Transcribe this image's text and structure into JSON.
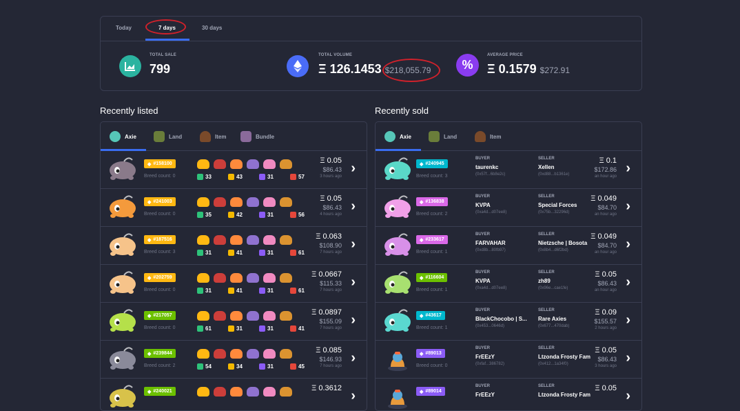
{
  "stats": {
    "tabs": [
      "Today",
      "7 days",
      "30 days"
    ],
    "total_sale": {
      "label": "TOTAL SALE",
      "value": "799"
    },
    "total_volume": {
      "label": "TOTAL VOLUME",
      "value": "Ξ 126.1453",
      "usd": "$218,055.79"
    },
    "average_price": {
      "label": "AVERAGE PRICE",
      "value": "Ξ 0.1579",
      "usd": "$272.91"
    },
    "icons": {
      "total_sale": "chart-icon",
      "total_volume": "ethereum-icon",
      "average_price": "percent-icon"
    }
  },
  "listed": {
    "title": "Recently listed",
    "tabs": [
      "Axie",
      "Land",
      "Item",
      "Bundle"
    ],
    "rows": [
      {
        "id": "#158100",
        "class_color": "#ffb812",
        "breed": "Breed count: 0",
        "hp": "33",
        "speed": "43",
        "skill": "31",
        "morale": "57",
        "eth": "Ξ 0.05",
        "usd": "$86.43",
        "ago": "3 hours ago",
        "body": "#8a7a8a"
      },
      {
        "id": "#241003",
        "class_color": "#ffb812",
        "breed": "Breed count: 0",
        "hp": "35",
        "speed": "42",
        "skill": "31",
        "morale": "56",
        "eth": "Ξ 0.05",
        "usd": "$86.43",
        "ago": "4 hours ago",
        "body": "#f49a3c"
      },
      {
        "id": "#187516",
        "class_color": "#ffb812",
        "breed": "Breed count: 3",
        "hp": "31",
        "speed": "41",
        "skill": "31",
        "morale": "61",
        "eth": "Ξ 0.063",
        "usd": "$108.90",
        "ago": "7 hours ago",
        "body": "#f6c38a"
      },
      {
        "id": "#202759",
        "class_color": "#ffb812",
        "breed": "Breed count: 0",
        "hp": "31",
        "speed": "41",
        "skill": "31",
        "morale": "61",
        "eth": "Ξ 0.0667",
        "usd": "$115.33",
        "ago": "7 hours ago",
        "body": "#f6c38a"
      },
      {
        "id": "#217057",
        "class_color": "#6cc000",
        "breed": "Breed count: 0",
        "hp": "61",
        "speed": "31",
        "skill": "31",
        "morale": "41",
        "eth": "Ξ 0.0897",
        "usd": "$155.09",
        "ago": "7 hours ago",
        "body": "#b5e04a"
      },
      {
        "id": "#239844",
        "class_color": "#6cc000",
        "breed": "Breed count: 2",
        "hp": "54",
        "speed": "34",
        "skill": "31",
        "morale": "45",
        "eth": "Ξ 0.085",
        "usd": "$146.93",
        "ago": "7 hours ago",
        "body": "#8a8a9a"
      },
      {
        "id": "#240021",
        "class_color": "#6cc000",
        "breed": "",
        "hp": "",
        "speed": "",
        "skill": "",
        "morale": "",
        "eth": "Ξ 0.3612",
        "usd": "",
        "ago": "",
        "body": "#d8c24a"
      }
    ]
  },
  "sold": {
    "title": "Recently sold",
    "tabs": [
      "Axie",
      "Land",
      "Item"
    ],
    "buyer_label": "BUYER",
    "seller_label": "SELLER",
    "rows": [
      {
        "id": "#240945",
        "class_color": "#00b8ce",
        "breed": "Breed count: 3",
        "buyer": "taurenkc",
        "buyer_addr": "(0x57f...6b8e2c)",
        "seller": "Xellen",
        "seller_addr": "(0xd88...b1361e)",
        "eth": "Ξ 0.1",
        "usd": "$172.86",
        "ago": "an hour ago",
        "body": "#5ad8c8"
      },
      {
        "id": "#136838",
        "class_color": "#da69e8",
        "breed": "Breed count: 2",
        "buyer": "KVPA",
        "buyer_addr": "(0xa4d...d07ee8)",
        "seller": "Special Forces",
        "seller_addr": "(0x75b...32296d)",
        "eth": "Ξ 0.049",
        "usd": "$84.70",
        "ago": "an hour ago",
        "body": "#f0a0e8"
      },
      {
        "id": "#233617",
        "class_color": "#da69e8",
        "breed": "Breed count: 1",
        "buyer": "FARVAHAR",
        "buyer_addr": "(0xd8b...80fb97)",
        "seller": "Nietzsche | Bosota",
        "seller_addr": "(0x8b4...d6f2bd)",
        "eth": "Ξ 0.049",
        "usd": "$84.70",
        "ago": "an hour ago",
        "body": "#d890e8"
      },
      {
        "id": "#116604",
        "class_color": "#6cc000",
        "breed": "Breed count: 1",
        "buyer": "KVPA",
        "buyer_addr": "(0xa4d...d07ee8)",
        "seller": "zh89",
        "seller_addr": "(0x96e...cae1fe)",
        "eth": "Ξ 0.05",
        "usd": "$86.43",
        "ago": "an hour ago",
        "body": "#a8e070"
      },
      {
        "id": "#43617",
        "class_color": "#00b8ce",
        "breed": "Breed count: 1",
        "buyer": "BlackChocobo | S...",
        "buyer_addr": "(0x453...0646d)",
        "seller": "Rare Axies",
        "seller_addr": "(0x677...470dab)",
        "eth": "Ξ 0.09",
        "usd": "$155.57",
        "ago": "2 hours ago",
        "body": "#5ad8d0"
      },
      {
        "id": "#89013",
        "class_color": "#8b5cf6",
        "breed": "Breed count: 0",
        "buyer": "FrEEzY",
        "buyer_addr": "(0xfaf...386782)",
        "seller": "Ltzonda Frosty Fam",
        "seller_addr": "(0x412...1a34f0)",
        "eth": "Ξ 0.05",
        "usd": "$86.43",
        "ago": "3 hours ago",
        "body": "egg"
      },
      {
        "id": "#89014",
        "class_color": "#8b5cf6",
        "breed": "",
        "buyer": "FrEEzY",
        "buyer_addr": "",
        "seller": "Ltzonda Frosty Fam",
        "seller_addr": "",
        "eth": "Ξ 0.05",
        "usd": "",
        "ago": "",
        "body": "egg"
      }
    ]
  },
  "colors": {
    "bg": "#242735",
    "accent": "#3a6df0",
    "annotation": "#d0212b"
  }
}
